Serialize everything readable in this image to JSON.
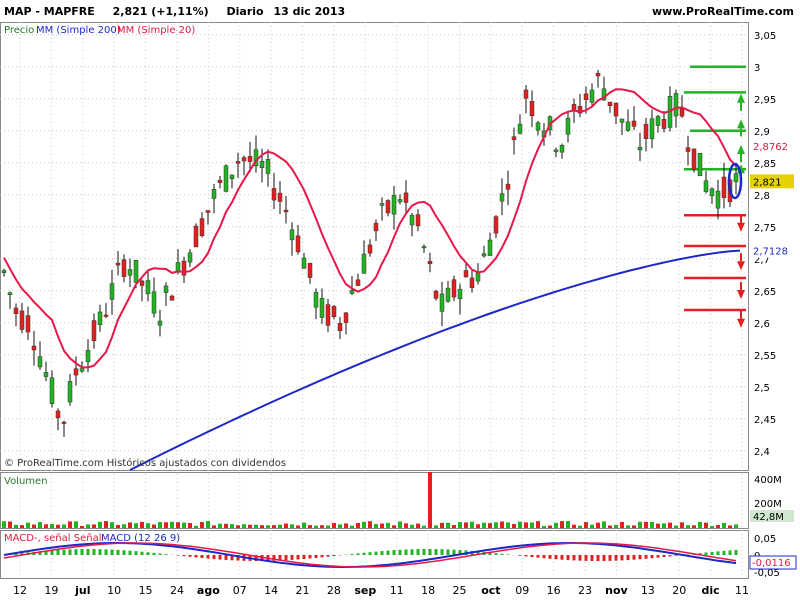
{
  "header": {
    "symbol": "MAP - MAPFRE",
    "quote": "2,821 (+1,11%)",
    "period": "Diario",
    "date": "13 dic 2013",
    "site": "www.ProRealTime.com"
  },
  "legend": {
    "price": "Precio",
    "ma200": "MM (Simple 200)",
    "ma20": "MM (Simple 20)"
  },
  "watermark": "© ProRealTime.com  Históricos ajustados con dividendos",
  "volume_label": "Volumen",
  "macd_label": {
    "part1": "MACD-, señal Señal",
    "part2": "MACD (12 26 9)"
  },
  "colors": {
    "up": "#22b322",
    "down": "#e32020",
    "ma20": "#e8174a",
    "ma200": "#1c28c8",
    "grid": "#c8c8c8",
    "last_price_bg": "#e6d200",
    "ma20_tag": "#d81c3c",
    "ma200_tag": "#1c28c8"
  },
  "price_axis": {
    "min": 2.37,
    "max": 3.07,
    "ticks": [
      "3,05",
      "3",
      "2,95",
      "2,9",
      "2,85",
      "2,8",
      "2,75",
      "2,7",
      "2,65",
      "2,6",
      "2,55",
      "2,5",
      "2,45",
      "2,4"
    ],
    "tick_values": [
      3.05,
      3.0,
      2.95,
      2.9,
      2.85,
      2.8,
      2.75,
      2.7,
      2.65,
      2.6,
      2.55,
      2.5,
      2.45,
      2.4
    ],
    "tags": {
      "ma20": "2,8762",
      "last": "2,821",
      "ma200": "2,7128"
    }
  },
  "volume_axis": {
    "ticks": [
      "400M",
      "200M"
    ],
    "last": "42,8M"
  },
  "macd_axis": {
    "ticks": [
      "0,05",
      "0",
      "-0,05"
    ],
    "last": "-0,0116"
  },
  "x_axis_labels": [
    "12",
    "19",
    "jul",
    "10",
    "15",
    "24",
    "ago",
    "07",
    "14",
    "21",
    "28",
    "sep",
    "11",
    "18",
    "25",
    "oct",
    "09",
    "16",
    "23",
    "nov",
    "13",
    "20",
    "dic",
    "11"
  ],
  "levels": {
    "resistance": [
      3.0,
      2.96,
      2.9,
      2.84
    ],
    "support": [
      2.768,
      2.72,
      2.67,
      2.62
    ]
  },
  "chart_data": {
    "type": "candlestick",
    "title": "MAP - MAPFRE Diario",
    "series": [
      {
        "name": "MM (Simple 200)",
        "start": 2.37,
        "end": 2.7128
      },
      {
        "name": "MM (Simple 20)",
        "last": 2.8762
      },
      {
        "name": "Precio",
        "last": 2.821,
        "change_pct": 1.11
      }
    ],
    "ylim": [
      2.37,
      3.07
    ]
  }
}
